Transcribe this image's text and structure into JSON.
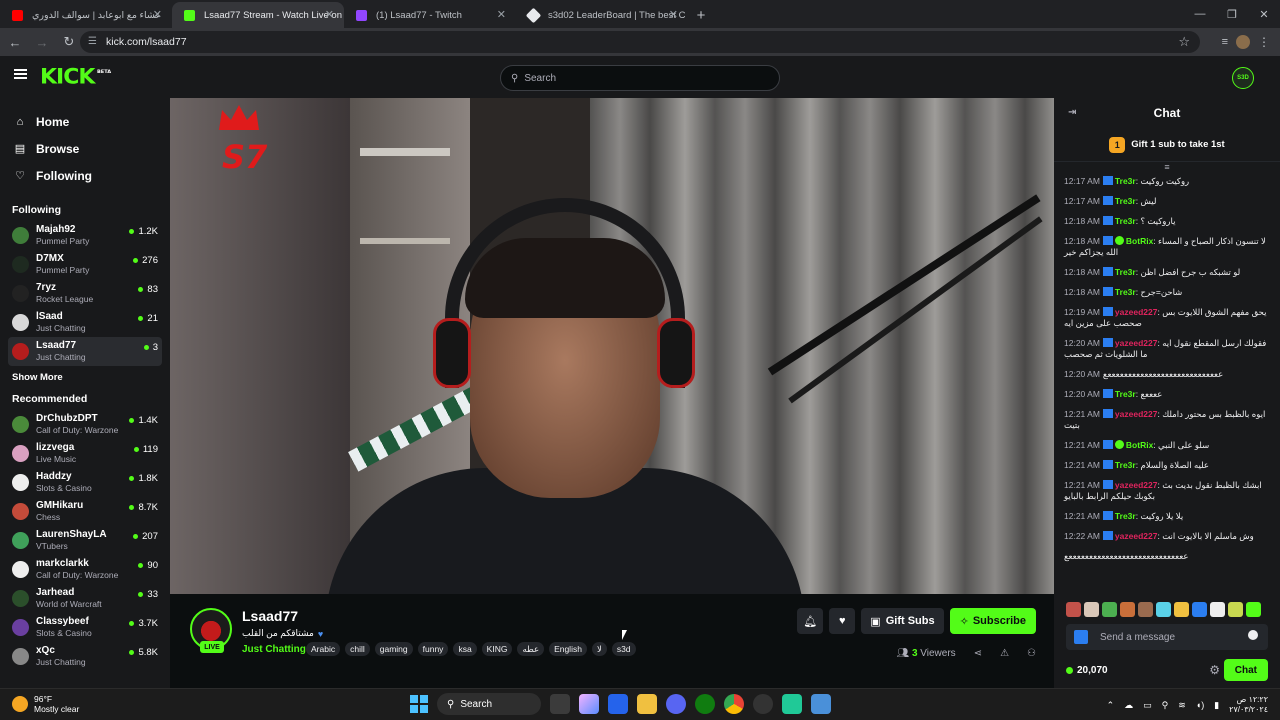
{
  "browser": {
    "tabs": [
      {
        "title": "عشاء مع ابوعابد | سوالف الدوري",
        "fav_color": "#ff0000"
      },
      {
        "title": "Lsaad77 Stream - Watch Live on Kick",
        "fav_color": "#53fc18"
      },
      {
        "title": "(1) Lsaad77 - Twitch",
        "fav_color": "#9146ff"
      },
      {
        "title": "s3d02 LeaderBoard | The best C",
        "fav_color": "#e8eaed"
      }
    ],
    "url": "kick.com/lsaad77"
  },
  "header": {
    "logo": "KICK",
    "logo_badge": "BETA",
    "search_placeholder": "Search",
    "user_initials": "S3D"
  },
  "sidebar": {
    "nav": [
      {
        "label": "Home",
        "icon": "⌂"
      },
      {
        "label": "Browse",
        "icon": "▤"
      },
      {
        "label": "Following",
        "icon": "♡"
      }
    ],
    "following_title": "Following",
    "following": [
      {
        "name": "Majah92",
        "category": "Pummel Party",
        "viewers": "1.2K",
        "color": "#3f7d3a"
      },
      {
        "name": "D7MX",
        "category": "Pummel Party",
        "viewers": "276",
        "color": "#1e2a20"
      },
      {
        "name": "7ryz",
        "category": "Rocket League",
        "viewers": "83",
        "color": "#222"
      },
      {
        "name": "lSaad",
        "category": "Just Chatting",
        "viewers": "21",
        "color": "#d8d8d8"
      },
      {
        "name": "Lsaad77",
        "category": "Just Chatting",
        "viewers": "3",
        "color": "#b51d1d"
      }
    ],
    "show_more": "Show More",
    "recommended_title": "Recommended",
    "recommended": [
      {
        "name": "DrChubzDPT",
        "category": "Call of Duty: Warzone",
        "viewers": "1.4K",
        "color": "#4a8a3a"
      },
      {
        "name": "lizzvega",
        "category": "Live Music",
        "viewers": "119",
        "color": "#d9a0c0"
      },
      {
        "name": "Haddzy",
        "category": "Slots & Casino",
        "viewers": "1.8K",
        "color": "#eee"
      },
      {
        "name": "GMHikaru",
        "category": "Chess",
        "viewers": "8.7K",
        "color": "#c44b3a"
      },
      {
        "name": "LaurenShayLA",
        "category": "VTubers",
        "viewers": "207",
        "color": "#3fa05a"
      },
      {
        "name": "markclarkk",
        "category": "Call of Duty: Warzone",
        "viewers": "90",
        "color": "#eee"
      },
      {
        "name": "Jarhead",
        "category": "World of Warcraft",
        "viewers": "33",
        "color": "#2b4f2b"
      },
      {
        "name": "Classybeef",
        "category": "Slots & Casino",
        "viewers": "3.7K",
        "color": "#6a3fa0"
      },
      {
        "name": "xQc",
        "category": "Just Chatting",
        "viewers": "5.8K",
        "color": "#888"
      }
    ]
  },
  "video": {
    "overlay_text": "S7"
  },
  "stream": {
    "name": "Lsaad77",
    "live": "LIVE",
    "title": "مشتاقكم من القلب",
    "category": "Just Chatting",
    "tags": [
      "Arabic",
      "chill",
      "gaming",
      "funny",
      "ksa",
      "KING",
      "عطه",
      "English",
      "لا",
      "s3d"
    ],
    "gift_label": "Gift Subs",
    "subscribe_label": "Subscribe",
    "viewers": "3",
    "viewers_label": "Viewers"
  },
  "chat": {
    "title": "Chat",
    "gift_rank": "1",
    "gift_text": "Gift 1 sub to take 1st",
    "messages": [
      {
        "time": "12:17 AM",
        "user": "Tre3r",
        "text": "روكيت روكيت",
        "color": "#53fc18",
        "badge": "b"
      },
      {
        "time": "12:17 AM",
        "user": "Tre3r",
        "text": "ليش",
        "color": "#53fc18",
        "badge": "b"
      },
      {
        "time": "12:18 AM",
        "user": "Tre3r",
        "text": "ياروكيت ؟",
        "color": "#53fc18",
        "badge": "b"
      },
      {
        "time": "12:18 AM",
        "user": "BotRix",
        "text": "لا تنسون اذكار الصباح و المساء الله يجزاكم خير",
        "color": "#53fc18",
        "badge": "v"
      },
      {
        "time": "12:18 AM",
        "user": "Tre3r",
        "text": "لو تشبكه ب جرح افضل اظن",
        "color": "#53fc18",
        "badge": "b"
      },
      {
        "time": "12:18 AM",
        "user": "Tre3r",
        "text": "شاحن=جرح",
        "color": "#53fc18",
        "badge": "b"
      },
      {
        "time": "12:19 AM",
        "user": "yazeed227",
        "text": "يحق مفهم الشوق اللايوت بس صحصب على مزين ايه",
        "color": "#e0245e",
        "badge": "b"
      },
      {
        "time": "12:20 AM",
        "user": "yazeed227",
        "text": "فقولك ارسل المقطع نقول ايه ما الشلويات ثم صحصب",
        "color": "#e0245e",
        "badge": "b"
      },
      {
        "time": "12:20 AM",
        "user": "",
        "text": "ععععععععععععععععععععععععععععع",
        "color": "#efeff1",
        "badge": ""
      },
      {
        "time": "12:20 AM",
        "user": "Tre3r",
        "text": "ععععع",
        "color": "#53fc18",
        "badge": "b"
      },
      {
        "time": "12:21 AM",
        "user": "yazeed227",
        "text": "ايوه بالظبط بس محتور داملك بتيت",
        "color": "#e0245e",
        "badge": "b"
      },
      {
        "time": "12:21 AM",
        "user": "BotRix",
        "text": "سلو على النبي",
        "color": "#53fc18",
        "badge": "v"
      },
      {
        "time": "12:21 AM",
        "user": "Tre3r",
        "text": "عليه الصلاة والسلام",
        "color": "#53fc18",
        "badge": "b"
      },
      {
        "time": "12:21 AM",
        "user": "yazeed227",
        "text": "ابشك بالظبط نقول بديت بث بكوبك حيلكم الرابط بالبايو",
        "color": "#e0245e",
        "badge": "b"
      },
      {
        "time": "12:21 AM",
        "user": "Tre3r",
        "text": "يلا يلا روكيت",
        "color": "#53fc18",
        "badge": "b"
      },
      {
        "time": "12:22 AM",
        "user": "yazeed227",
        "text": "وش ماسلم الا بالايوت انت",
        "color": "#e0245e",
        "badge": "b"
      },
      {
        "time": "",
        "user": "",
        "text": "عععععععععععععععععععععععععععععع",
        "color": "#efeff1",
        "badge": ""
      }
    ],
    "emote_colors": [
      "#c2524a",
      "#d9c7b8",
      "#4caf50",
      "#c96f3a",
      "#9a6b4f",
      "#5ad1e8",
      "#f0c040",
      "#2b7ef1",
      "#eee",
      "#c8d850",
      "#53fc18"
    ],
    "input_placeholder": "Send a message",
    "points": "20,070",
    "chat_button": "Chat"
  },
  "taskbar": {
    "temp": "96°F",
    "weather": "Mostly clear",
    "search": "Search",
    "time": "١٢:٢٢ ص",
    "date": "٢٧/٠٣/٢٠٢٤"
  }
}
